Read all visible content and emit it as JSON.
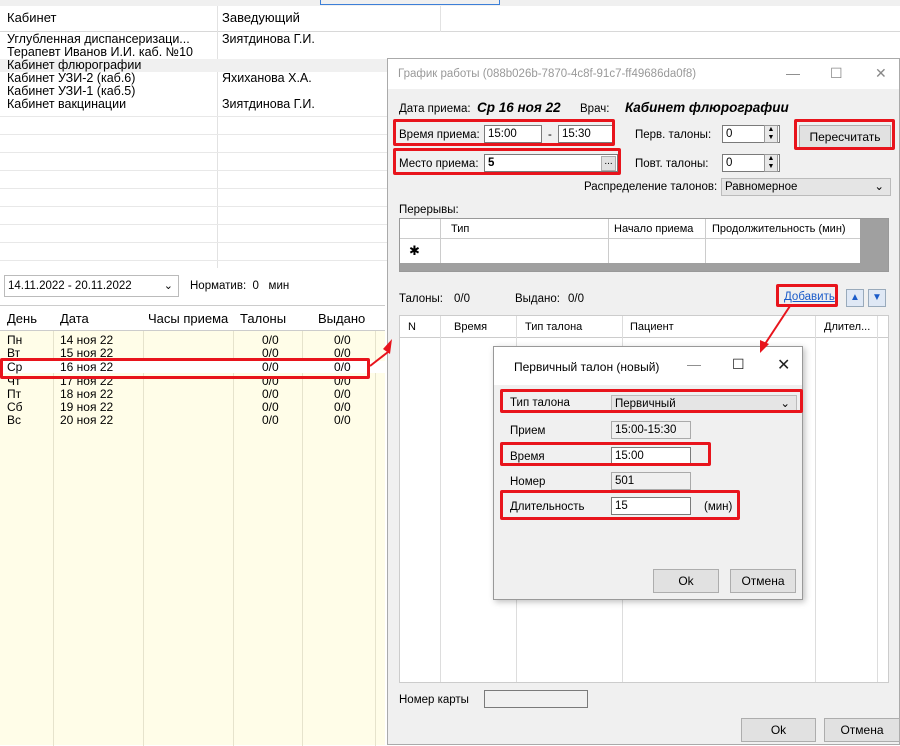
{
  "cabinets": {
    "headers": [
      "Кабинет",
      "Заведующий"
    ],
    "rows": [
      {
        "name": "Углубленная диспансеризаци...",
        "head": "Зиятдинова Г.И."
      },
      {
        "name": "Терапевт Иванов И.И. каб. №10",
        "head": ""
      },
      {
        "name": "Кабинет флюрографии",
        "head": ""
      },
      {
        "name": "Кабинет УЗИ-2 (каб.6)",
        "head": "Яхиханова Х.А."
      },
      {
        "name": "Кабинет УЗИ-1 (каб.5)",
        "head": ""
      },
      {
        "name": "Кабинет вакцинации",
        "head": "Зиятдинова Г.И."
      }
    ]
  },
  "filter": {
    "period": "14.11.2022 - 20.11.2022",
    "norm_label": "Норматив:",
    "norm_value": "0",
    "norm_unit": "мин"
  },
  "days": {
    "headers": [
      "День",
      "Дата",
      "Часы приема",
      "Талоны",
      "Выдано"
    ],
    "rows": [
      {
        "day": "Пн",
        "date": "14 ноя 22",
        "hours": "",
        "tickets": "0/0",
        "issued": "0/0"
      },
      {
        "day": "Вт",
        "date": "15 ноя 22",
        "hours": "",
        "tickets": "0/0",
        "issued": "0/0"
      },
      {
        "day": "Ср",
        "date": "16 ноя 22",
        "hours": "",
        "tickets": "0/0",
        "issued": "0/0"
      },
      {
        "day": "Чт",
        "date": "17 ноя 22",
        "hours": "",
        "tickets": "0/0",
        "issued": "0/0"
      },
      {
        "day": "Пт",
        "date": "18 ноя 22",
        "hours": "",
        "tickets": "0/0",
        "issued": "0/0"
      },
      {
        "day": "Сб",
        "date": "19 ноя 22",
        "hours": "",
        "tickets": "0/0",
        "issued": "0/0"
      },
      {
        "day": "Вс",
        "date": "20 ноя 22",
        "hours": "",
        "tickets": "0/0",
        "issued": "0/0"
      }
    ]
  },
  "schedule": {
    "title": "График работы (088b026b-7870-4c8f-91c7-ff49686da0f8)",
    "date_label": "Дата приема:",
    "date_value": "Ср  16 ноя 22",
    "doctor_label": "Врач:",
    "doctor_value": "Кабинет флюрографии",
    "time_label": "Время приема:",
    "time_from": "15:00",
    "time_dash": "-",
    "time_to": "15:30",
    "place_label": "Место приема:",
    "place_value": "5",
    "place_btn": "...",
    "first_tickets_label": "Перв. талоны:",
    "first_tickets_value": "0",
    "repeat_tickets_label": "Повт. талоны:",
    "repeat_tickets_value": "0",
    "recalc_btn": "Пересчитать",
    "distribution_label": "Распределение талонов:",
    "distribution_value": "Равномерное",
    "breaks_label": "Перерывы:",
    "breaks_headers": [
      "Тип",
      "Начало приема",
      "Продолжительность (мин)"
    ],
    "new_row_marker": "✱",
    "tickets_label": "Талоны:",
    "tickets_value": "0/0",
    "issued_label": "Выдано:",
    "issued_value": "0/0",
    "add_link": "Добавить",
    "tickets_headers": [
      "N",
      "Время",
      "Тип талона",
      "Пациент",
      "Длител..."
    ],
    "card_label": "Номер карты",
    "card_value": "",
    "ok_btn": "Ok",
    "cancel_btn": "Отмена"
  },
  "ticket_dialog": {
    "title": "Первичный талон (новый)",
    "type_label": "Тип талона",
    "type_value": "Первичный",
    "reception_label": "Прием",
    "reception_value": "15:00-15:30",
    "time_label": "Время",
    "time_value": "15:00",
    "number_label": "Номер",
    "number_value": "501",
    "duration_label": "Длительность",
    "duration_value": "15",
    "duration_unit": "(мин)",
    "ok_btn": "Ok",
    "cancel_btn": "Отмена"
  },
  "colors": {
    "highlight": "#e8141c",
    "grid_bg": "#fffde8",
    "link": "#1a5bc9"
  }
}
